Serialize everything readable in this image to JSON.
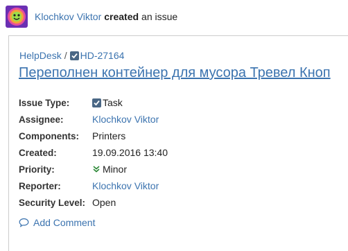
{
  "activity": {
    "actor": "Klochkov Viktor",
    "verb": "created",
    "object": "an issue"
  },
  "issue": {
    "project": "HelpDesk",
    "separator": "/",
    "key": "HD-27164",
    "title": "Переполнен контейнер для мусора Тревел Кноп",
    "fields": [
      {
        "label": "Issue Type:",
        "value": "Task"
      },
      {
        "label": "Assignee:",
        "value": "Klochkov Viktor"
      },
      {
        "label": "Components:",
        "value": "Printers"
      },
      {
        "label": "Created:",
        "value": "19.09.2016 13:40"
      },
      {
        "label": "Priority:",
        "value": "Minor"
      },
      {
        "label": "Reporter:",
        "value": "Klochkov Viktor"
      },
      {
        "label": "Security Level:",
        "value": "Open"
      }
    ]
  },
  "actions": {
    "add_comment": "Add Comment"
  },
  "icons": {
    "avatar": "user-avatar",
    "issue_type": "task-checkbox-icon",
    "priority": "minor-priority-chevrons-icon",
    "comment": "comment-bubble-icon"
  },
  "colors": {
    "link": "#3b73af",
    "task_icon": "#4a6785",
    "priority_minor": "#2a8735",
    "border": "#cccccc"
  }
}
